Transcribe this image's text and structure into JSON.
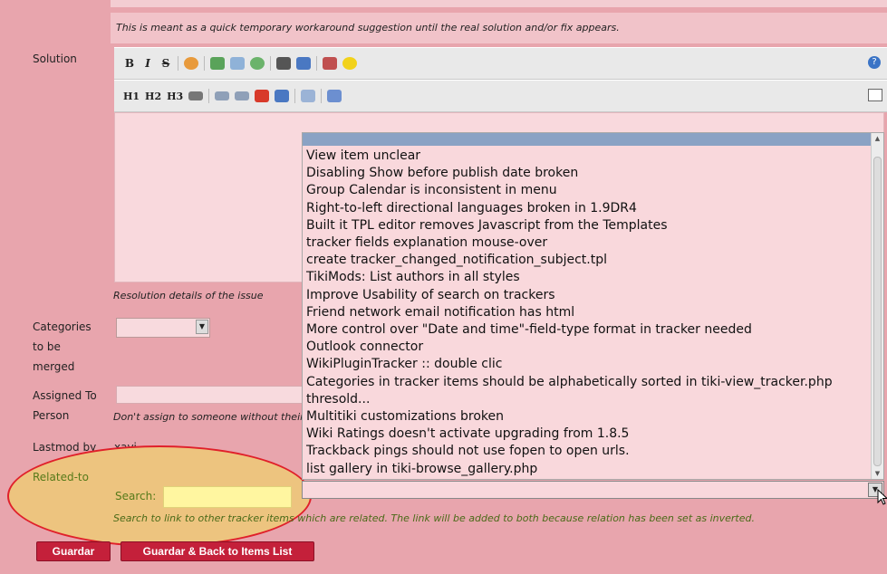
{
  "form": {
    "description_note": "This is meant as a quick temporary workaround suggestion until the real solution and/or fix appears.",
    "solution_label": "Solution",
    "resolution_note": "Resolution details of the issue",
    "categories_label_line1": "Categories",
    "categories_label_line2": "to be",
    "categories_label_line3": "merged",
    "assigned_label_line1": "Assigned To",
    "assigned_label_line2": "Person",
    "assigned_note": "Don't assign to someone without their",
    "lastmod_label": "Lastmod by",
    "lastmod_value": "xavi",
    "related_label": "Related-to",
    "search_label": "Search:",
    "search_value": "",
    "search_note": "Search to link to other tracker items which are related. The link will be added to both because relation has been set as inverted."
  },
  "toolbar1": {
    "bold": "B",
    "italic": "I",
    "strike": "S"
  },
  "toolbar2": {
    "h1": "H1",
    "h2": "H2",
    "h3": "H3"
  },
  "related_options": [
    "View item unclear",
    "Disabling Show before publish date broken",
    "Group Calendar is inconsistent in menu",
    "Right-to-left directional languages broken in 1.9DR4",
    "Built it TPL editor removes Javascript from the Templates",
    "tracker fields explanation mouse-over",
    "create tracker_changed_notification_subject.tpl",
    "TikiMods: List authors in all styles",
    "Improve Usability of search on trackers",
    "Friend network email notification has html",
    "More control over \"Date and time\"-field-type format in tracker needed",
    "Outlook connector",
    "WikiPluginTracker :: double clic",
    "Categories in tracker items should be alphabetically sorted in tiki-view_tracker.php",
    "thresold...",
    "Multitiki customizations broken",
    "Wiki Ratings doesn't activate upgrading from 1.8.5",
    "Trackback pings should not use fopen to open urls.",
    "list gallery in tiki-browse_gallery.php"
  ],
  "buttons": {
    "save": "Guardar",
    "save_back": "Guardar & Back to Items List"
  },
  "colors": {
    "background": "#e8a5ad",
    "button": "#c4203a",
    "highlight": "#edc47f",
    "highlight_outline": "#e0202a",
    "list_selected": "#8aa2c4"
  }
}
